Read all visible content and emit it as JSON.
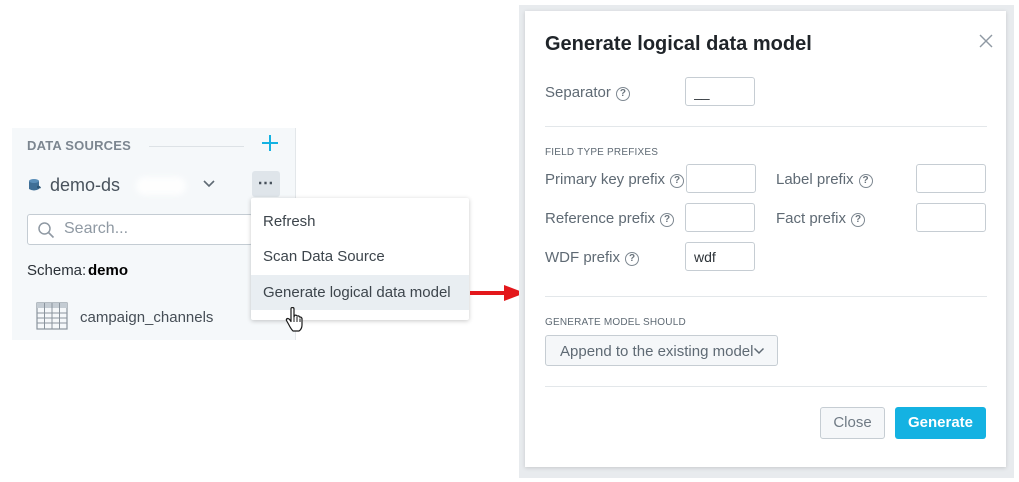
{
  "data_sources": {
    "heading": "DATA SOURCES",
    "datasource_name": "demo-ds",
    "more_label": "⋯",
    "search": {
      "placeholder": "Search..."
    },
    "schema_label": "Schema:",
    "schema_value": "demo",
    "tables": [
      {
        "name": "campaign_channels"
      }
    ]
  },
  "context_menu": {
    "items": [
      {
        "label": "Refresh"
      },
      {
        "label": "Scan Data Source"
      },
      {
        "label": "Generate logical data model"
      }
    ],
    "active_item": "Generate logical data model"
  },
  "dialog": {
    "title": "Generate logical data model",
    "separator": {
      "label": "Separator",
      "value": "__"
    },
    "field_type_prefixes": {
      "section_title": "FIELD TYPE PREFIXES",
      "primary_key": {
        "label": "Primary key prefix",
        "value": ""
      },
      "label_prefix": {
        "label": "Label prefix",
        "value": ""
      },
      "reference": {
        "label": "Reference prefix",
        "value": ""
      },
      "fact": {
        "label": "Fact prefix",
        "value": ""
      },
      "wdf": {
        "label": "WDF prefix",
        "value": "wdf"
      }
    },
    "generate_model_should": {
      "section_title": "GENERATE MODEL SHOULD",
      "selected": "Append to the existing model"
    },
    "buttons": {
      "close": "Close",
      "generate": "Generate"
    }
  },
  "icons": {
    "add": "plus-icon",
    "datasource": "database-icon",
    "search": "search-icon",
    "table": "table-icon",
    "close": "close-icon",
    "help": "question-circle-icon",
    "cursor": "hand-pointer-icon",
    "arrow": "red-arrow-right"
  },
  "colors": {
    "accent": "#14b2e2",
    "arrow": "#e3171b",
    "panel_background": "#f5f8fa",
    "menu_active": "#e9eef2"
  }
}
